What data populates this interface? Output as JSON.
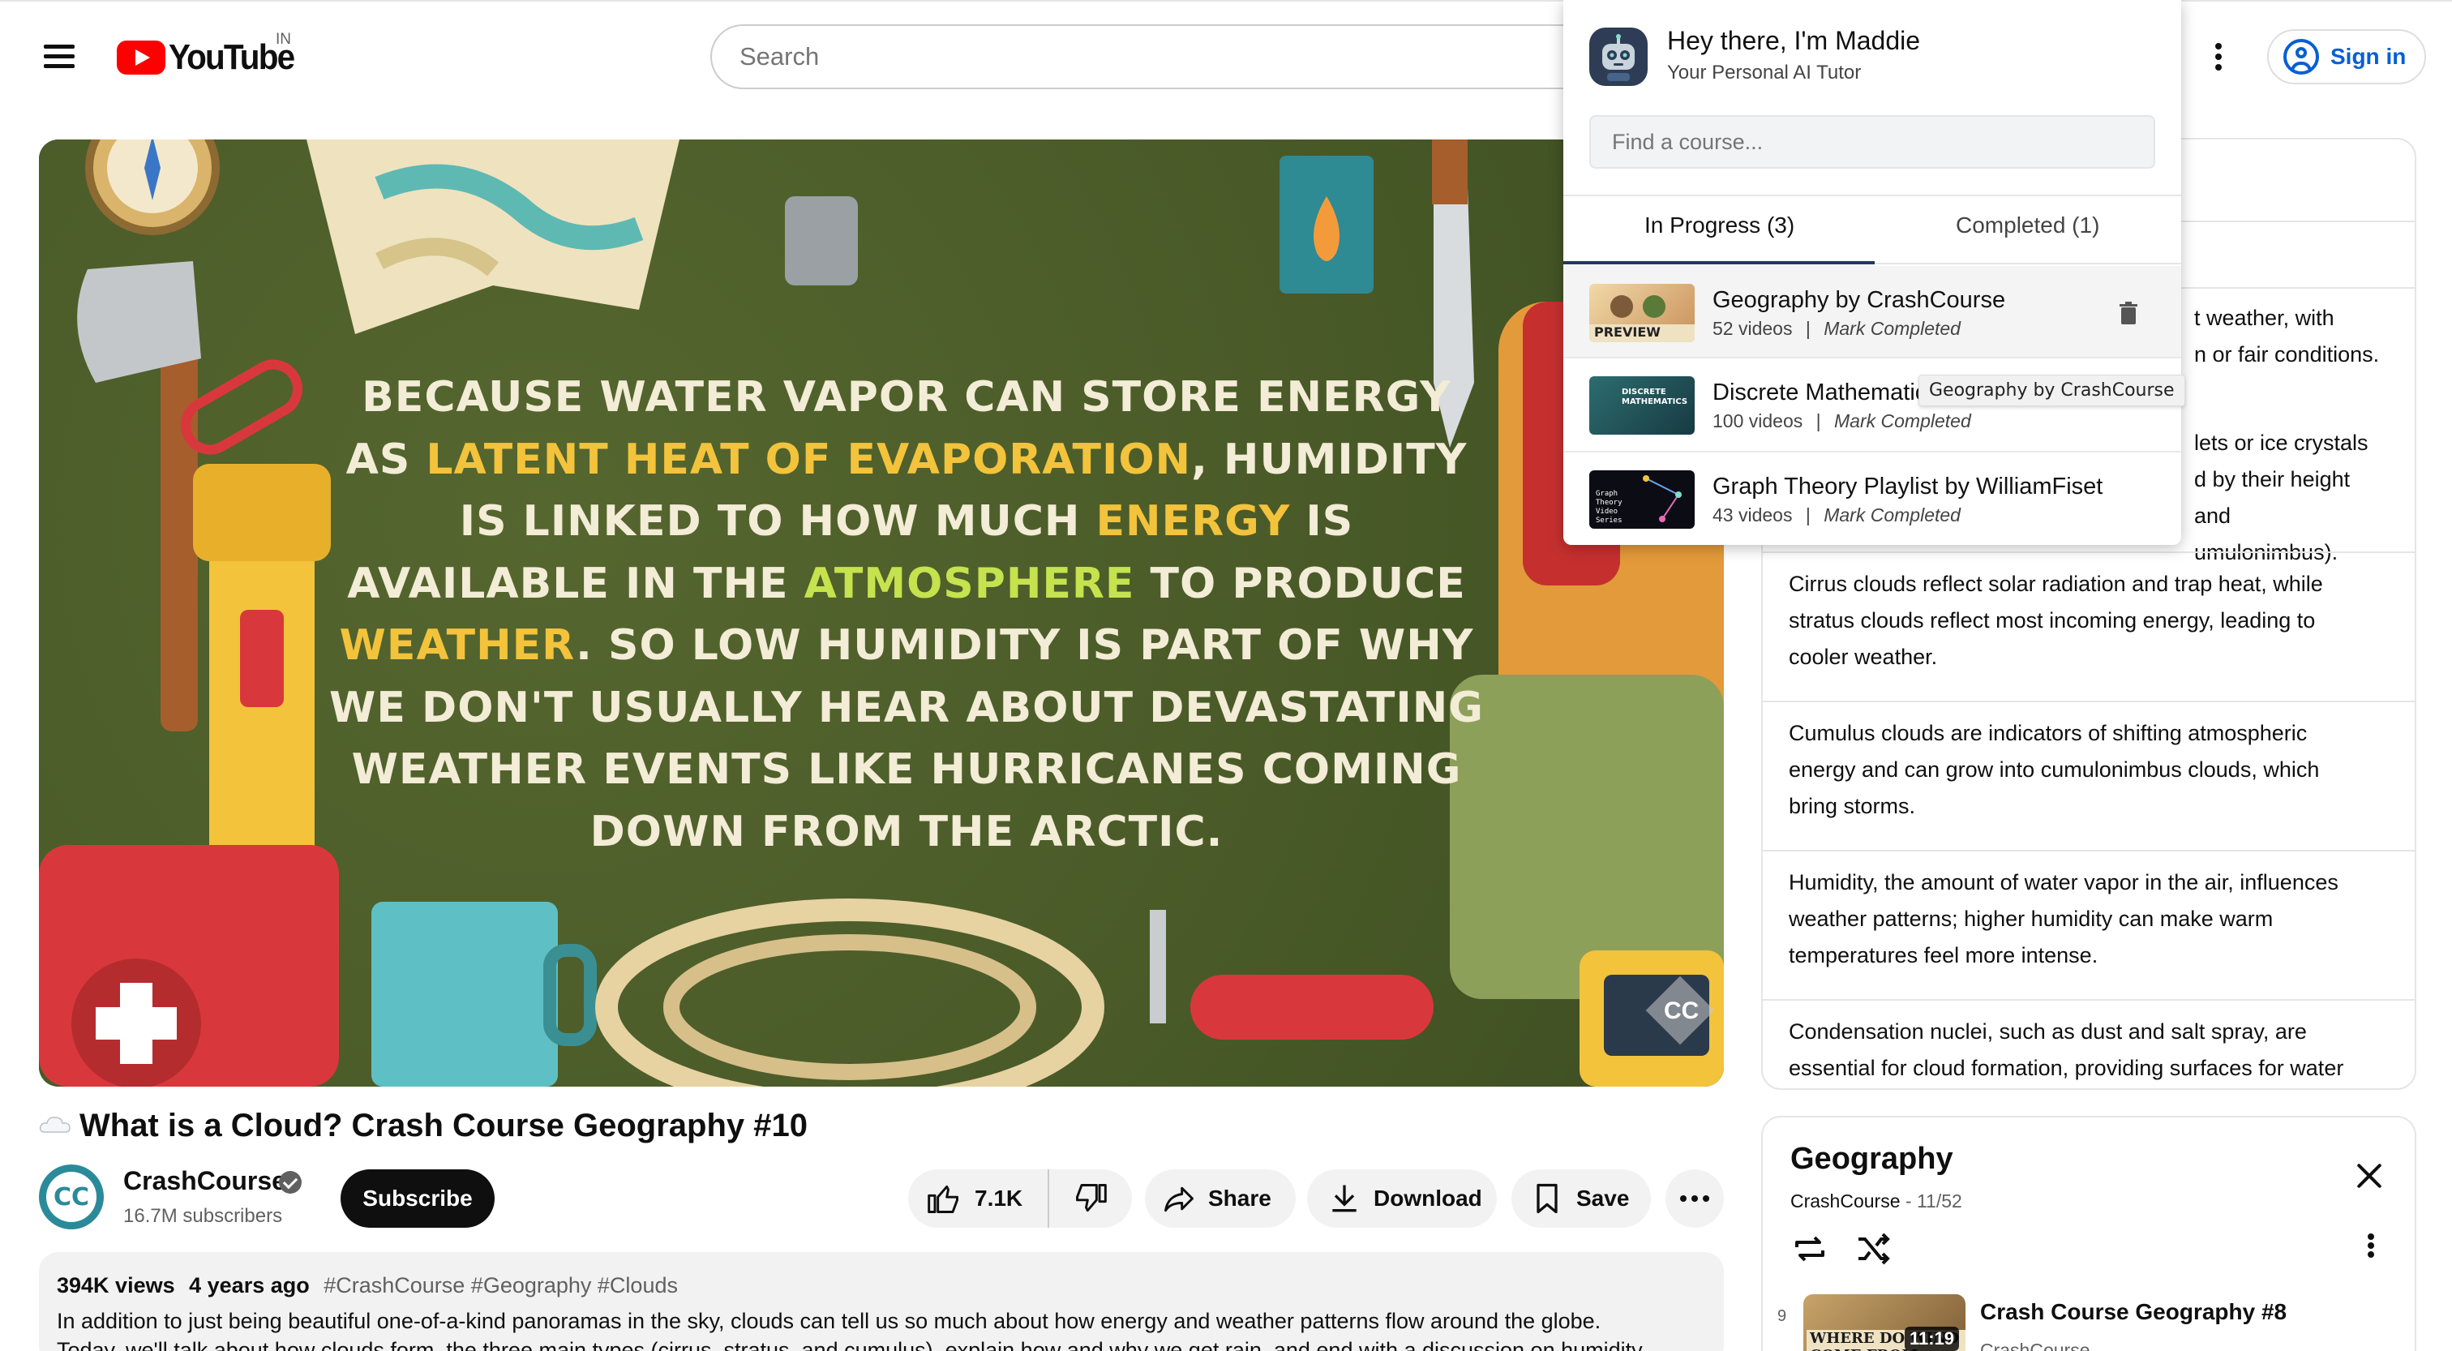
{
  "header": {
    "logo_text": "YouTube",
    "country_code": "IN",
    "search_placeholder": "Search",
    "sign_in_label": "Sign in"
  },
  "player": {
    "caption_lines": [
      [
        {
          "t": "BECAUSE WATER VAPOR CAN STORE ENERGY",
          "c": ""
        }
      ],
      [
        {
          "t": "AS ",
          "c": ""
        },
        {
          "t": "LATENT HEAT OF EVAPORATION",
          "c": "hl"
        },
        {
          "t": ", HUMIDITY",
          "c": ""
        }
      ],
      [
        {
          "t": "IS LINKED TO HOW MUCH ",
          "c": ""
        },
        {
          "t": "ENERGY",
          "c": "hl"
        },
        {
          "t": " IS",
          "c": ""
        }
      ],
      [
        {
          "t": "AVAILABLE IN THE ",
          "c": ""
        },
        {
          "t": "ATMOSPHERE",
          "c": "hg"
        },
        {
          "t": " TO PRODUCE",
          "c": ""
        }
      ],
      [
        {
          "t": "WEATHER",
          "c": "hl"
        },
        {
          "t": ". SO LOW HUMIDITY IS PART OF WHY",
          "c": ""
        }
      ],
      [
        {
          "t": "WE DON'T USUALLY HEAR ABOUT DEVASTATING",
          "c": ""
        }
      ],
      [
        {
          "t": "WEATHER EVENTS LIKE HURRICANES COMING",
          "c": ""
        }
      ],
      [
        {
          "t": "DOWN FROM THE ARCTIC.",
          "c": ""
        }
      ]
    ],
    "watermark": "CC",
    "colors": {
      "background": "#4a5a2c",
      "highlight_yellow": "#f3c33c",
      "highlight_green": "#c6e24e",
      "text": "#f3ecd6"
    }
  },
  "video": {
    "title": "What is a Cloud? Crash Course Geography #10",
    "channel_name": "CrashCourse",
    "channel_avatar_text": "CC",
    "subscribers": "16.7M subscribers",
    "subscribe_label": "Subscribe",
    "likes": "7.1K",
    "share_label": "Share",
    "download_label": "Download",
    "save_label": "Save"
  },
  "description": {
    "views": "394K views",
    "age": "4 years ago",
    "tags": "#CrashCourse #Geography #Clouds",
    "text_line1": "In addition to just being beautiful one-of-a-kind panoramas in the sky, clouds can tell us so much about how energy and weather patterns flow around the globe.",
    "text_line2": "Today, we'll talk about how clouds form, the three main types (cirrus, stratus, and cumulus), explain how and why we get rain, and end with a discussion on humidity"
  },
  "summary": {
    "items": [
      {
        "lines": [
          "",
          "t weather, with",
          "n or fair conditions."
        ]
      },
      {
        "lines": [
          "lets or ice crystals",
          "d by their height and",
          "umulonimbus)."
        ]
      },
      {
        "lines": [
          "Cirrus clouds reflect solar radiation and trap heat, while",
          "stratus clouds reflect most incoming energy, leading to",
          "cooler weather."
        ]
      },
      {
        "lines": [
          "Cumulus clouds are indicators of shifting atmospheric",
          "energy and can grow into cumulonimbus clouds, which",
          "bring storms."
        ]
      },
      {
        "lines": [
          "Humidity, the amount of water vapor in the air, influences",
          "weather patterns; higher humidity can make warm",
          "temperatures feel more intense."
        ]
      },
      {
        "lines": [
          "Condensation nuclei, such as dust and salt spray, are",
          "essential for cloud formation, providing surfaces for water"
        ]
      }
    ]
  },
  "playlist": {
    "title": "Geography",
    "channel": "CrashCourse",
    "position": "11/52",
    "row": {
      "index": "9",
      "title": "Crash Course Geography #8",
      "channel": "CrashCourse",
      "duration": "11:19",
      "thumb_caption": "WHERE DO WIND COME FROM"
    }
  },
  "tutor": {
    "greeting": "Hey there, I'm Maddie",
    "subtitle": "Your Personal AI Tutor",
    "find_placeholder": "Find a course...",
    "tab_in_progress": "In Progress (3)",
    "tab_completed": "Completed (1)",
    "courses": [
      {
        "name": "Geography by CrashCourse",
        "videos": "52 videos",
        "action": "Mark Completed",
        "thumb_label": "PREVIEW"
      },
      {
        "name": "Discrete Mathematic",
        "videos": "100 videos",
        "action": "Mark Completed",
        "thumb_label": "DISCRETE MATHEMATICS"
      },
      {
        "name": "Graph Theory Playlist by WilliamFiset",
        "videos": "43 videos",
        "action": "Mark Completed",
        "thumb_label": "Graph Theory Video Series"
      }
    ],
    "tooltip": "Geography by CrashCourse"
  }
}
